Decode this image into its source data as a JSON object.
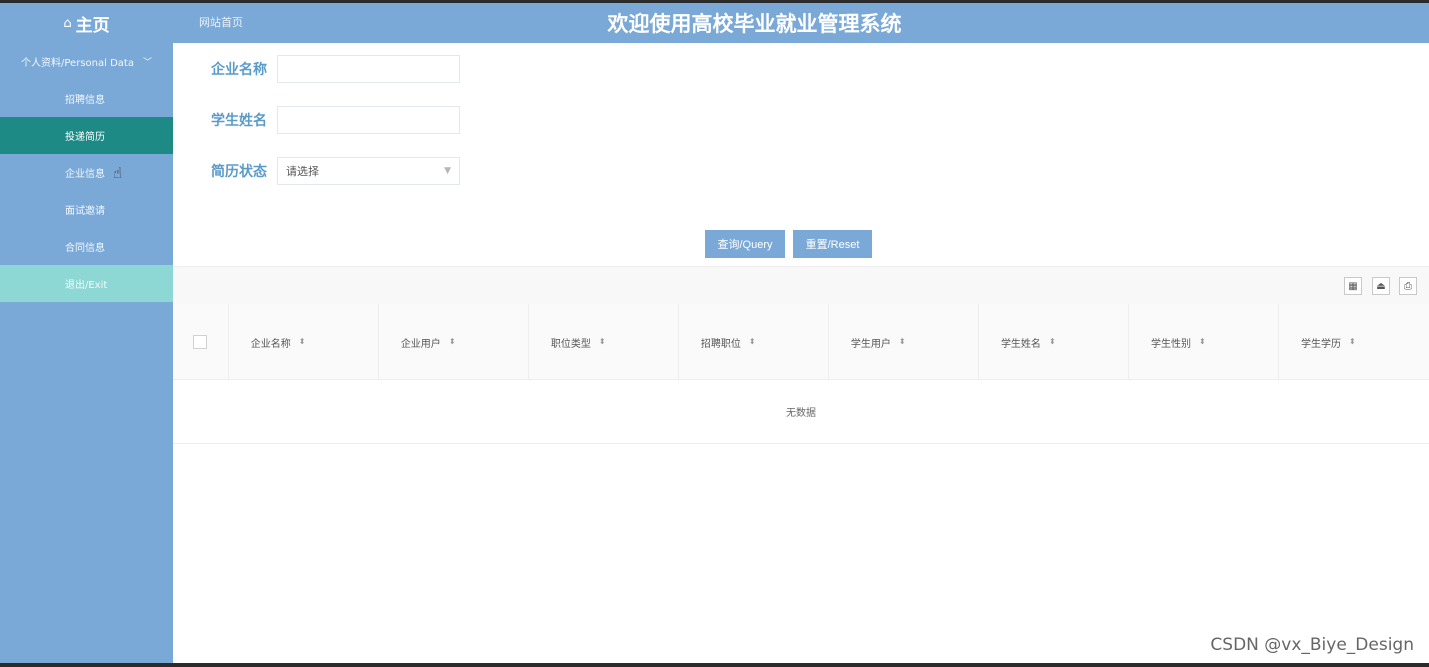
{
  "header": {
    "home_label": "主页",
    "home_icon": "home-icon",
    "site_home_link": "网站首页",
    "title": "欢迎使用高校毕业就业管理系统"
  },
  "sidebar": {
    "group_label": "个人资料/Personal Data",
    "items": [
      {
        "label": "招聘信息",
        "state": "normal"
      },
      {
        "label": "投递简历",
        "state": "active"
      },
      {
        "label": "企业信息",
        "state": "hover"
      },
      {
        "label": "面试邀请",
        "state": "normal"
      },
      {
        "label": "合同信息",
        "state": "normal"
      },
      {
        "label": "退出/Exit",
        "state": "exit"
      }
    ]
  },
  "search": {
    "company_name_label": "企业名称",
    "company_name_value": "",
    "student_name_label": "学生姓名",
    "student_name_value": "",
    "resume_status_label": "简历状态",
    "resume_status_selected": "请选择",
    "query_button": "查询/Query",
    "reset_button": "重置/Reset"
  },
  "toolbar": {
    "icons": [
      "columns-icon",
      "export-icon",
      "print-icon"
    ]
  },
  "table": {
    "columns": [
      "企业名称",
      "企业用户",
      "职位类型",
      "招聘职位",
      "学生用户",
      "学生姓名",
      "学生性别",
      "学生学历"
    ],
    "rows": [],
    "empty_text": "无数据"
  },
  "colors": {
    "primary": "#7aa9d7",
    "active_menu": "#1d8a86",
    "exit_menu": "#8dd7d4",
    "label": "#5b9bc9"
  },
  "watermark": "CSDN @vx_Biye_Design"
}
